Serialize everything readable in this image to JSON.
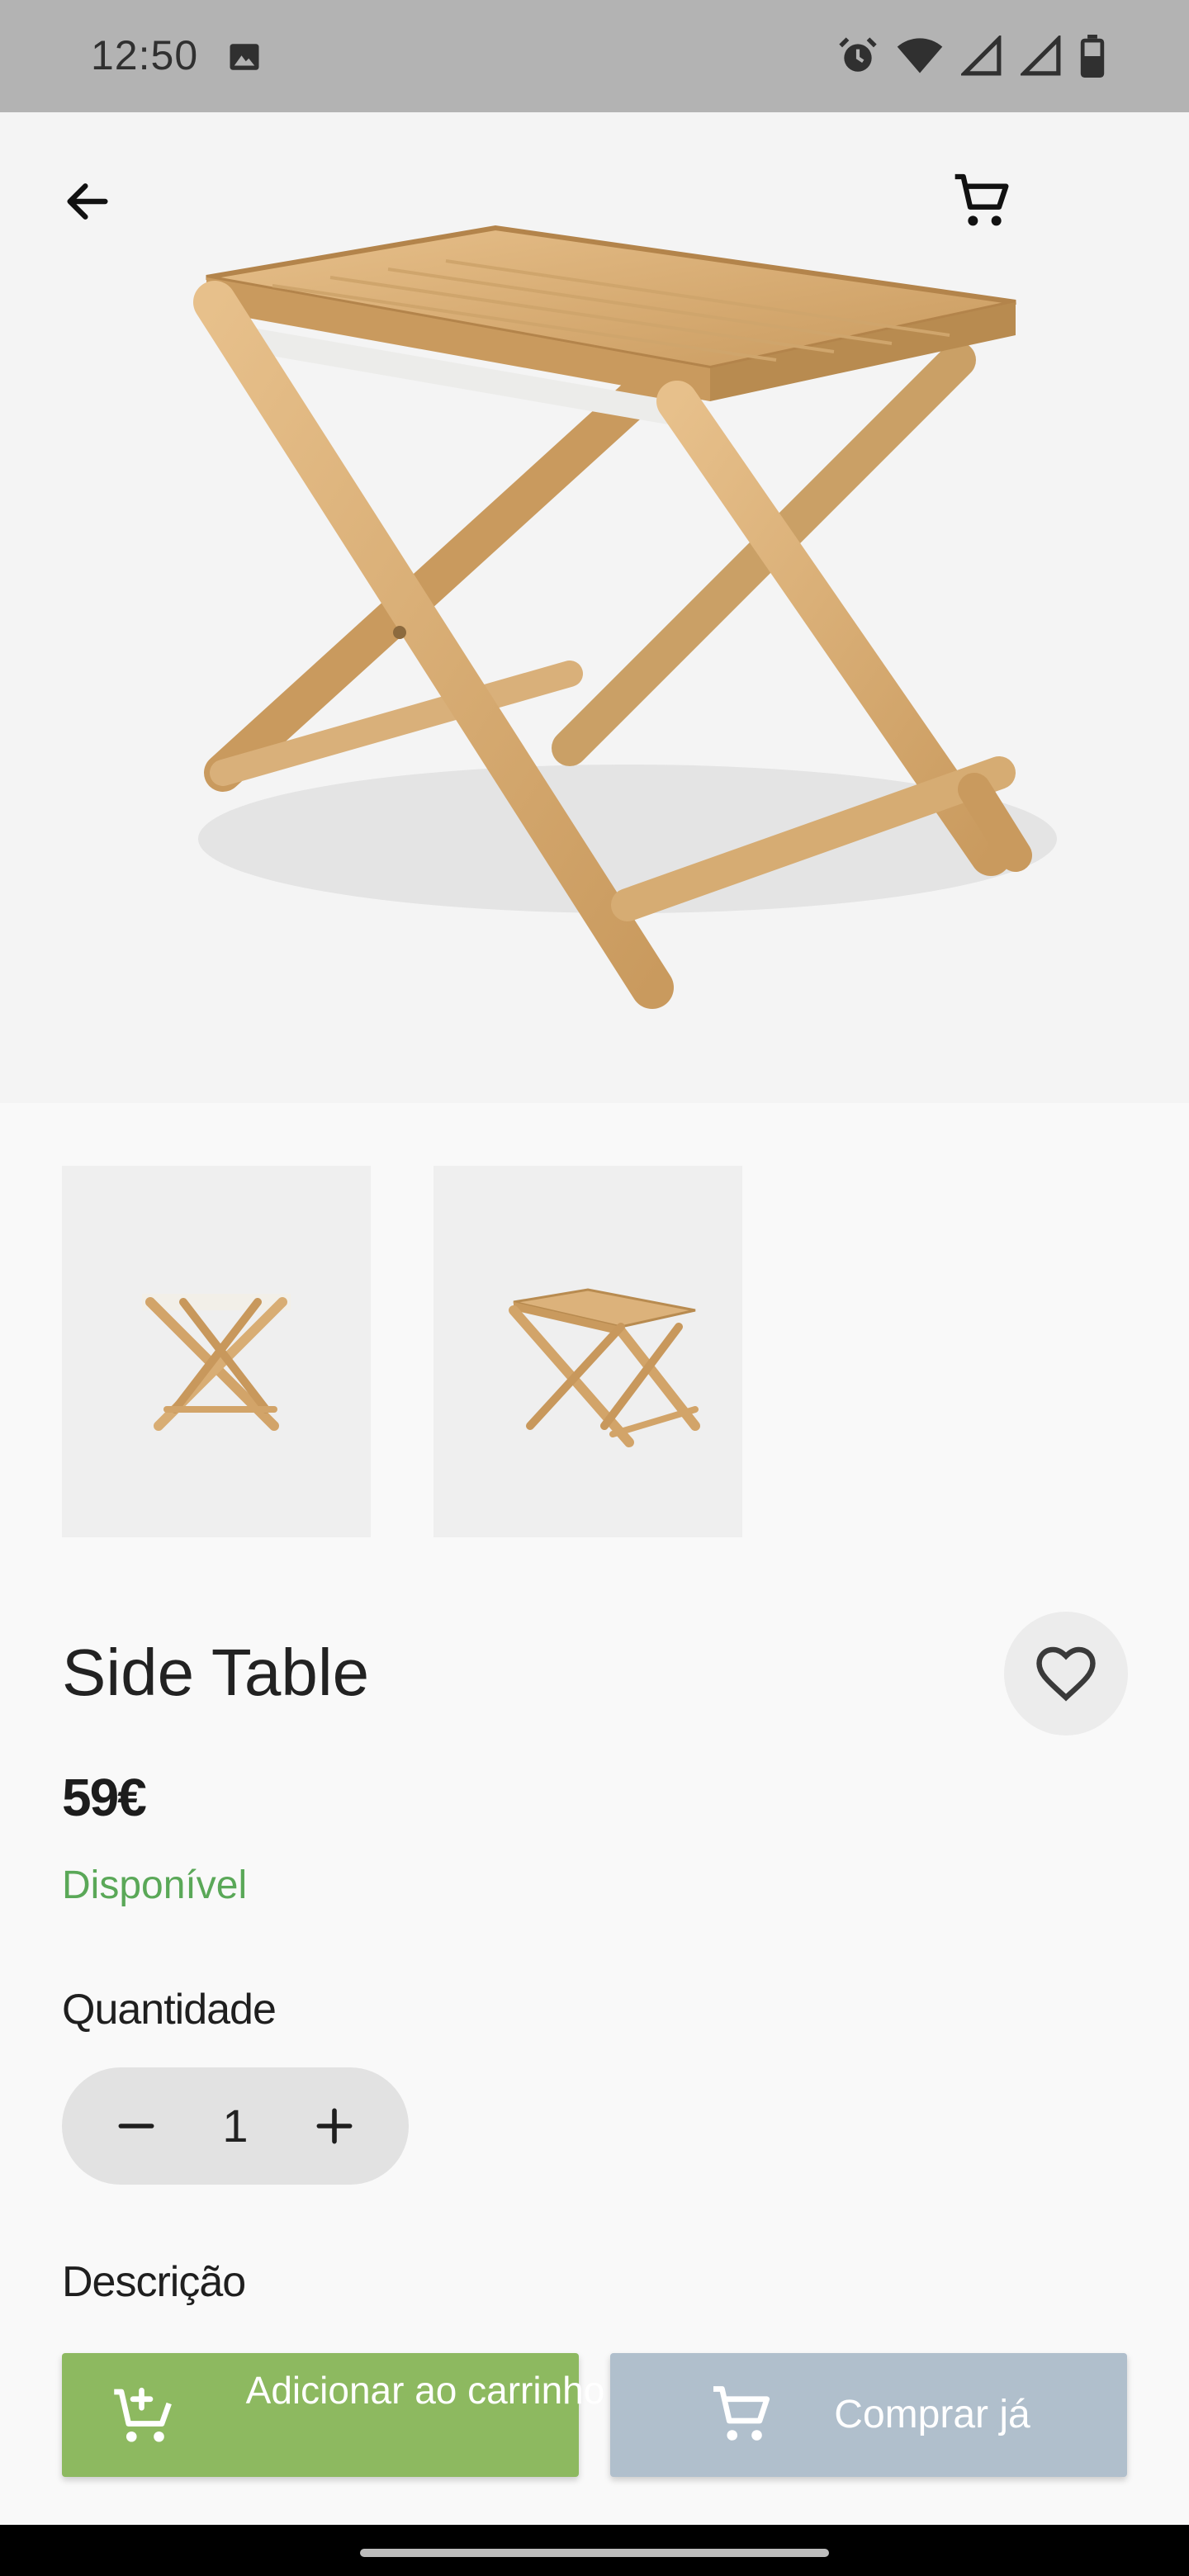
{
  "status_bar": {
    "time": "12:50",
    "icons": [
      "image-icon",
      "alarm-icon",
      "wifi-icon",
      "signal-icon",
      "signal-icon",
      "battery-icon"
    ]
  },
  "header": {
    "back_icon": "arrow-left-icon",
    "cart_icon": "cart-icon"
  },
  "gallery": {
    "thumbnails": [
      "thumbnail-1",
      "thumbnail-2"
    ]
  },
  "product": {
    "title": "Side Table",
    "price": "59€",
    "availability": "Disponível",
    "favorite_icon": "heart-outline-icon"
  },
  "quantity": {
    "label": "Quantidade",
    "value": "1"
  },
  "description": {
    "label": "Descrição"
  },
  "actions": {
    "add_to_cart": "Adicionar ao carrinho",
    "buy_now": "Comprar já"
  },
  "colors": {
    "add_button": "#8db960",
    "buy_button": "#b0bfcc",
    "available": "#5aa858"
  }
}
